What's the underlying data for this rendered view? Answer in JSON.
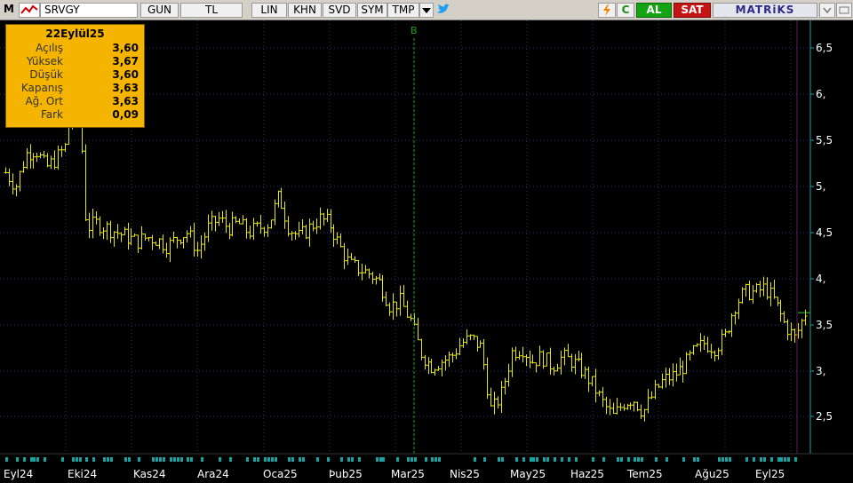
{
  "toolbar": {
    "m_label": "M",
    "symbol": "SRVGY",
    "gun": "GUN",
    "tl": "TL",
    "lin": "LIN",
    "khn": "KHN",
    "svd": "SVD",
    "sym": "SYM",
    "tmp": "TMP",
    "dropdown_icon": "caret-down-icon",
    "twitter_icon": "twitter-icon",
    "flash_icon": "flash-icon",
    "refresh_label": "C",
    "buy": "AL",
    "sell": "SAT",
    "brand": "MATRiKS",
    "menu_icon": "chevron-icon"
  },
  "info": {
    "date": "22Eylül25",
    "rows": [
      {
        "label": "Açılış",
        "value": "3,60"
      },
      {
        "label": "Yüksek",
        "value": "3,67"
      },
      {
        "label": "Düşük",
        "value": "3,60"
      },
      {
        "label": "Kapanış",
        "value": "3,63"
      },
      {
        "label": "Ağ. Ort",
        "value": "3,63"
      },
      {
        "label": "Fark",
        "value": "0,09"
      }
    ]
  },
  "colors": {
    "background": "#000000",
    "bars": "#e8e800",
    "axis_text": "#ffffff",
    "grid": "#1c3a6e",
    "marker": "#1aa31a",
    "axis_line": "#1aa3a3",
    "cursor_line": "#5a1f5a"
  },
  "chart_data": {
    "type": "ohlc",
    "marker_label": "B",
    "ylim": [
      2.1,
      6.8
    ],
    "y_ticks": [
      "6,5",
      "6,",
      "5,5",
      "5,",
      "4,5",
      "4,",
      "3,5",
      "3,",
      "2,5"
    ],
    "y_tick_values": [
      6.5,
      6.0,
      5.5,
      5.0,
      4.5,
      4.0,
      3.5,
      3.0,
      2.5
    ],
    "x_labels": [
      "Eyl24",
      "Eki24",
      "Kas24",
      "Ara24",
      "Oca25",
      "Þub25",
      "Mar25",
      "Nis25",
      "May25",
      "Haz25",
      "Tem25",
      "Ağu25",
      "Eyl25"
    ],
    "close_series": [
      5.15,
      5.0,
      5.35,
      5.4,
      5.2,
      5.3,
      5.45,
      6.6,
      4.55,
      4.6,
      4.55,
      4.5,
      4.45,
      4.4,
      4.45,
      4.42,
      4.35,
      4.45,
      4.5,
      4.3,
      4.55,
      4.65,
      4.55,
      4.6,
      4.5,
      4.55,
      4.6,
      4.9,
      4.55,
      4.45,
      4.55,
      4.65,
      4.6,
      4.35,
      4.15,
      4.1,
      4.05,
      3.95,
      3.7,
      3.75,
      3.55,
      3.2,
      3.05,
      3.1,
      3.15,
      3.3,
      3.35,
      3.25,
      2.55,
      2.75,
      3.2,
      3.25,
      3.1,
      3.15,
      3.05,
      3.15,
      3.1,
      3.0,
      2.85,
      2.65,
      2.5,
      2.65,
      2.7,
      2.55,
      2.75,
      2.9,
      2.95,
      3.05,
      3.2,
      3.3,
      3.25,
      3.35,
      3.7,
      3.85,
      3.85,
      3.9,
      3.75,
      3.5,
      3.35,
      3.63
    ]
  }
}
